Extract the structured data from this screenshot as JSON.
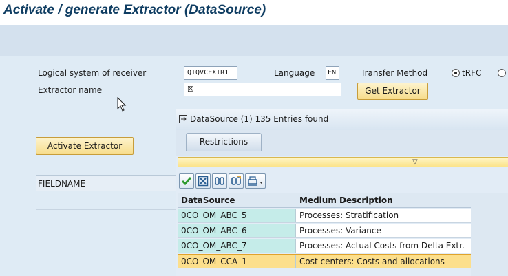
{
  "window": {
    "title": "Activate / generate Extractor (DataSource)"
  },
  "form": {
    "logical_system_label": "Logical system of receiver",
    "logical_system_value": "QTQVCEXTR1",
    "language_label": "Language",
    "language_value": "EN",
    "transfer_method_label": "Transfer Method",
    "transfer_option_trfc": "tRFC",
    "extractor_name_label": "Extractor name",
    "extractor_name_value": "☒",
    "get_extractor_button": "Get Extractor",
    "activate_extractor_button": "Activate Extractor",
    "fieldname_header": "FIELDNAME"
  },
  "popup": {
    "title": "DataSource (1)  135 Entries found",
    "tab_restrictions": "Restrictions",
    "columns": [
      "DataSource",
      "Medium Description"
    ],
    "rows": [
      {
        "datasource": "0CO_OM_ABC_5",
        "description": "Processes: Stratification",
        "selected": false
      },
      {
        "datasource": "0CO_OM_ABC_6",
        "description": "Processes: Variance",
        "selected": false
      },
      {
        "datasource": "0CO_OM_ABC_7",
        "description": "Processes: Actual Costs from Delta Extr.",
        "selected": false
      },
      {
        "datasource": "0CO_OM_CCA_1",
        "description": "Cost centers: Costs and allocations",
        "selected": true
      }
    ],
    "toolbar_icons": [
      "checkmark-icon",
      "close-x-icon",
      "find-icon",
      "find-next-icon",
      "print-icon"
    ]
  },
  "colors": {
    "title": "#0f3d62",
    "selected_row": "#fcdf8c",
    "key_column": "#c5ece9",
    "button": "#f7dd8c"
  }
}
